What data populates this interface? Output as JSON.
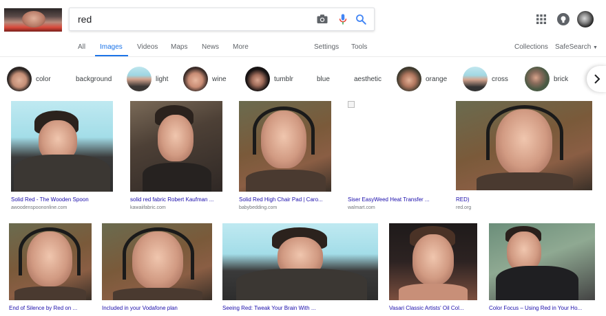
{
  "search": {
    "query": "red"
  },
  "icons": {
    "camera": "camera-icon",
    "mic": "mic-icon",
    "search": "search-icon",
    "apps": "apps-grid-icon",
    "notifications": "notifications-icon",
    "account": "account-avatar"
  },
  "tabs": {
    "all": "All",
    "images": "Images",
    "videos": "Videos",
    "maps": "Maps",
    "news": "News",
    "more": "More",
    "settings": "Settings",
    "tools": "Tools",
    "collections": "Collections",
    "safesearch": "SafeSearch"
  },
  "chips": [
    {
      "label": "color",
      "has_thumb": true
    },
    {
      "label": "background",
      "has_thumb": false
    },
    {
      "label": "light",
      "has_thumb": true
    },
    {
      "label": "wine",
      "has_thumb": true
    },
    {
      "label": "tumblr",
      "has_thumb": true
    },
    {
      "label": "blue",
      "has_thumb": false
    },
    {
      "label": "aesthetic",
      "has_thumb": false
    },
    {
      "label": "orange",
      "has_thumb": true
    },
    {
      "label": "cross",
      "has_thumb": true
    },
    {
      "label": "brick",
      "has_thumb": true
    }
  ],
  "results_row1": [
    {
      "title": "Solid Red - The Wooden Spoon",
      "source": "awoodenspoononline.com"
    },
    {
      "title": "solid red fabric Robert Kaufman ...",
      "source": "kawaiifabric.com"
    },
    {
      "title": "Solid Red High Chair Pad | Caro...",
      "source": "babybedding.com"
    },
    {
      "title": "Siser EasyWeed Heat Transfer ...",
      "source": "walmart.com"
    },
    {
      "title": "RED)",
      "source": "red.org"
    }
  ],
  "results_row2": [
    {
      "title": "End of Silence by Red on ..."
    },
    {
      "title": "Included in your Vodafone plan"
    },
    {
      "title": "Seeing Red: Tweak Your Brain With ..."
    },
    {
      "title": "Vasari Classic Artists' Oil Col..."
    },
    {
      "title": "Color Focus – Using Red in Your Ho..."
    }
  ],
  "colors": {
    "accent": "#1a73e8",
    "link": "#1a0dab",
    "muted": "#70757a"
  }
}
